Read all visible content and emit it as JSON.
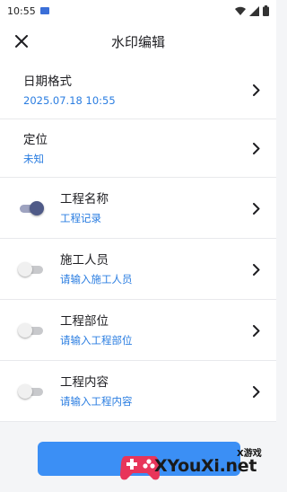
{
  "status_bar": {
    "time": "10:55"
  },
  "header": {
    "title": "水印编辑"
  },
  "rows": [
    {
      "label": "日期格式",
      "value": "2025.07.18 10:55",
      "toggle": null
    },
    {
      "label": "定位",
      "value": "未知",
      "toggle": null
    },
    {
      "label": "工程名称",
      "value": "工程记录",
      "toggle": "on"
    },
    {
      "label": "施工人员",
      "value": "请输入施工人员",
      "toggle": "off"
    },
    {
      "label": "工程部位",
      "value": "请输入工程部位",
      "toggle": "off"
    },
    {
      "label": "工程内容",
      "value": "请输入工程内容",
      "toggle": "off"
    }
  ],
  "watermark": {
    "small_text": "X游戏",
    "big_text": "XYouXi.net"
  },
  "colors": {
    "accent": "#2a7de1",
    "button": "#3b8ff5",
    "toggle_on": "#4f5a87"
  }
}
